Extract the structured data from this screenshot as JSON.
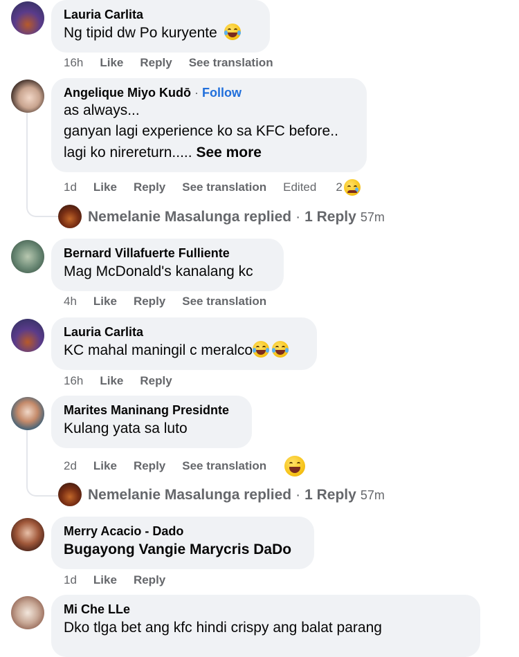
{
  "comments": [
    {
      "author": "Lauria Carlita",
      "text": "Ng tipid dw Po kuryente",
      "time": "16h",
      "like": "Like",
      "reply": "Reply",
      "see_translation": "See translation"
    },
    {
      "author": "Angelique Miyo Kudō",
      "follow": "Follow",
      "dot": "·",
      "lines": [
        "as always...",
        "ganyan lagi experience ko sa KFC before..",
        "lagi ko nirereturn....."
      ],
      "see_more": "See more",
      "time": "1d",
      "like": "Like",
      "reply": "Reply",
      "see_translation": "See translation",
      "edited": "Edited",
      "reaction_count": "2",
      "reply_summary": {
        "name": "Nemelanie Masalunga replied",
        "dot": "·",
        "count": "1 Reply",
        "ago": "57m"
      }
    },
    {
      "author": "Bernard Villafuerte Fulliente",
      "text": "Mag McDonald's kanalang kc",
      "time": "4h",
      "like": "Like",
      "reply": "Reply",
      "see_translation": "See translation"
    },
    {
      "author": "Lauria Carlita",
      "text": "KC mahal maningil c meralco",
      "time": "16h",
      "like": "Like",
      "reply": "Reply"
    },
    {
      "author": "Marites Maninang Presidnte",
      "text": "Kulang yata sa luto",
      "time": "2d",
      "like": "Like",
      "reply": "Reply",
      "see_translation": "See translation",
      "reply_summary": {
        "name": "Nemelanie Masalunga replied",
        "dot": "·",
        "count": "1 Reply",
        "ago": "57m"
      }
    },
    {
      "author": "Merry Acacio - Dado",
      "text": "Bugayong Vangie Marycris DaDo",
      "time": "1d",
      "like": "Like",
      "reply": "Reply"
    },
    {
      "author": "Mi Che LLe",
      "text": "Dko tlga bet ang kfc hindi crispy ang balat parang"
    }
  ],
  "icons": {
    "laugh": "laughing-emoji",
    "sad": "sad-reaction-emoji"
  },
  "colors": {
    "bubble": "#f0f2f5",
    "meta": "#65676b",
    "follow": "#216fdb"
  }
}
